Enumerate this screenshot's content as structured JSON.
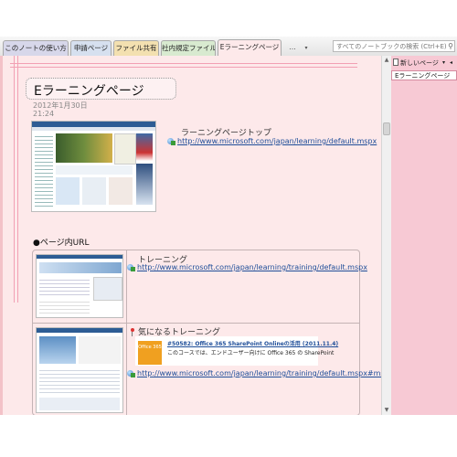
{
  "tabs": [
    {
      "label": "このノートの使い方",
      "color": "#d7d7ea",
      "active": false
    },
    {
      "label": "申請ページ",
      "color": "#d6e0ef",
      "active": false
    },
    {
      "label": "ファイル共有",
      "color": "#f3e0b0",
      "active": false
    },
    {
      "label": "社内規定ファイル",
      "color": "#d8ead0",
      "active": false
    },
    {
      "label": "Eラーニングページ",
      "color": "#fde9ea",
      "active": true
    }
  ],
  "tab_more": "...",
  "tab_more_arrow": "▾",
  "search": {
    "placeholder": "すべてのノートブックの検索 (Ctrl+E)",
    "icon": "search-icon"
  },
  "page": {
    "title": "Eラーニングページ",
    "date": "2012年1月30日",
    "time": "21:24",
    "top_link": {
      "label": "ラーニングページトップ",
      "url": "http://www.microsoft.com/japan/learning/default.mspx"
    },
    "section_heading": "●ページ内URL",
    "rows": [
      {
        "label": "トレーニング",
        "url": "http://www.microsoft.com/japan/learning/training/default.mspx"
      },
      {
        "label": "気になるトレーニング",
        "card_title": "#50582: Office 365 SharePoint Onlineの活用 (2011.11.4)",
        "card_desc": "このコースでは、エンドユーザー向けに Office 365 の SharePoint",
        "card_logo": "Office 365",
        "url": "http://www.microsoft.com/japan/learning/training/default.mspx#ms"
      }
    ]
  },
  "panel": {
    "new_page": "新しいページ",
    "arrow": "▾",
    "prev": "◂",
    "pages": [
      "Eラーニングページ"
    ]
  },
  "colors": {
    "accent_pink": "#f2a0b4",
    "page_bg": "#fde9ea",
    "link": "#1f4e99"
  }
}
